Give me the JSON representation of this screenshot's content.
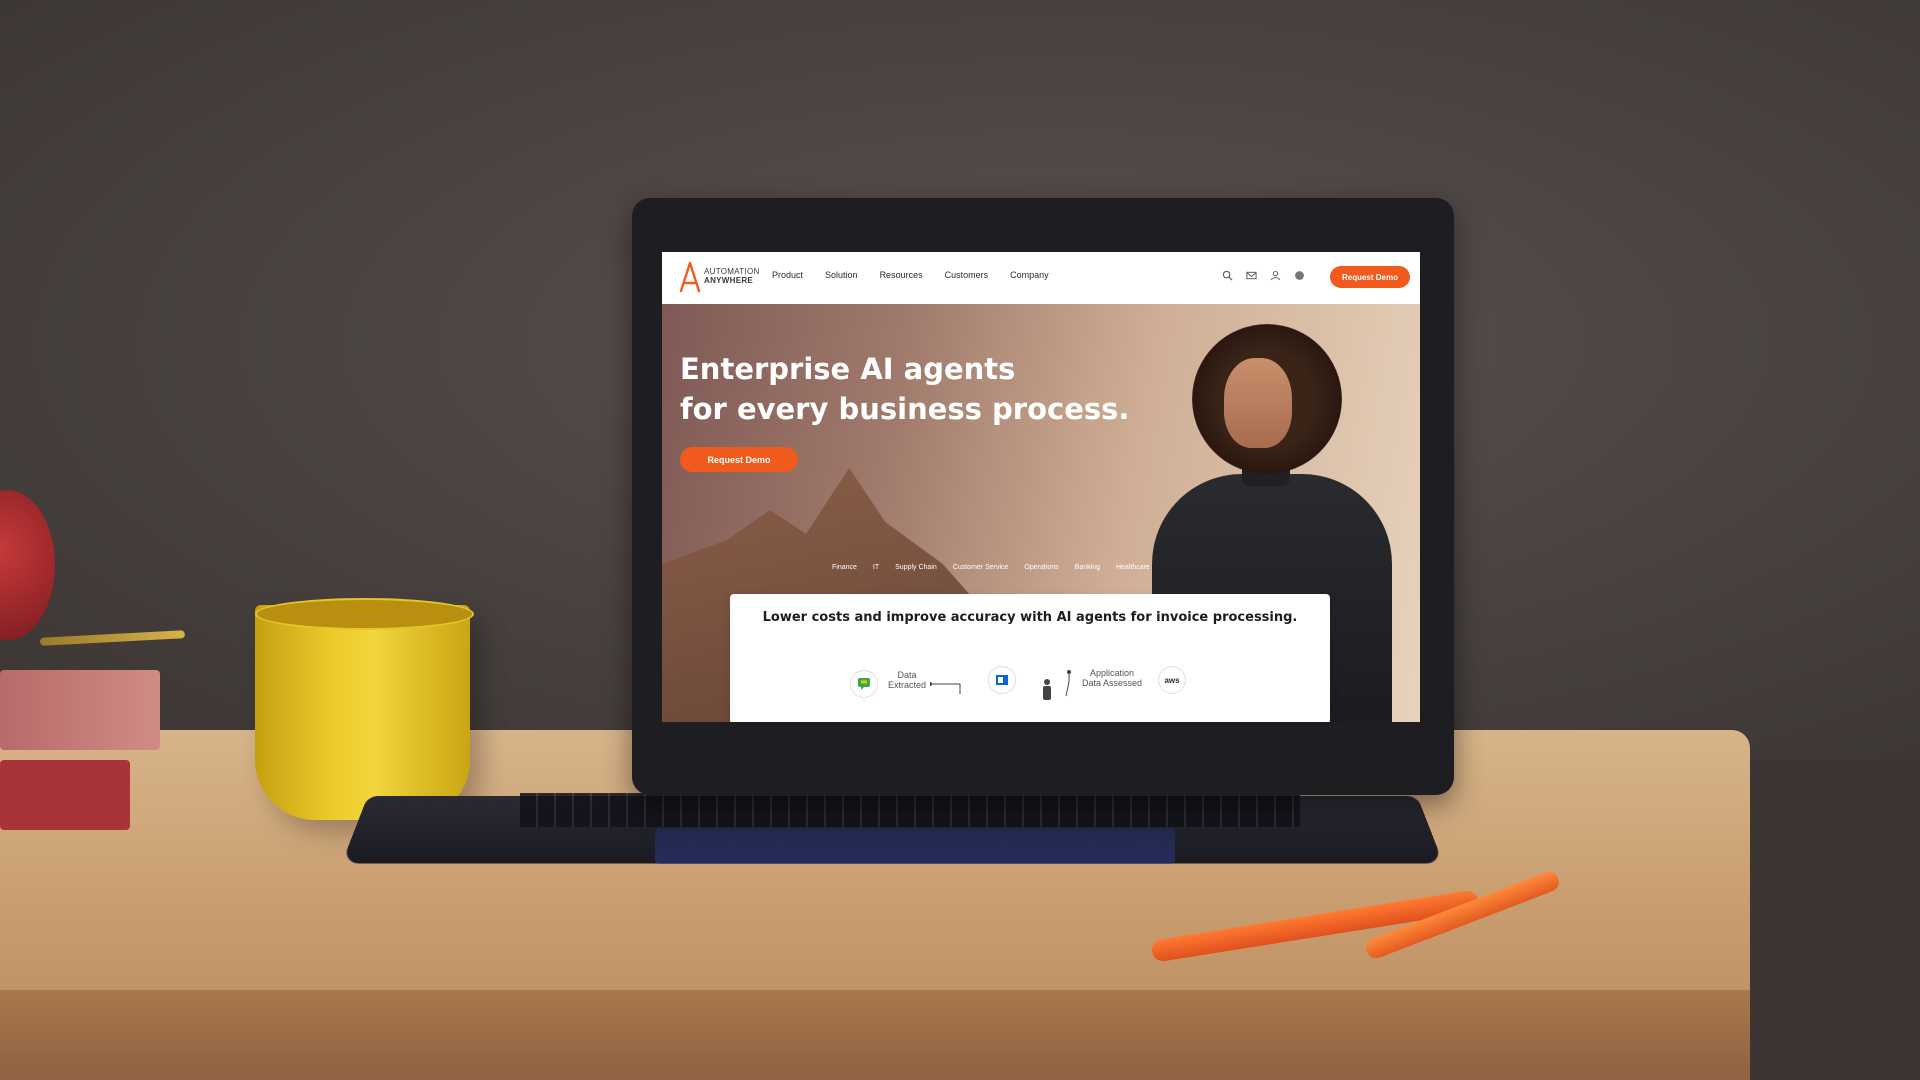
{
  "brand": {
    "logo_line1": "AUTOMATION",
    "logo_line2": "ANYWHERE",
    "accent_color": "#f05a1c"
  },
  "nav": {
    "items": [
      "Product",
      "Solution",
      "Resources",
      "Customers",
      "Company"
    ],
    "icons": [
      "search-icon",
      "mail-icon",
      "user-icon",
      "globe-icon"
    ],
    "cta_label": "Request Demo"
  },
  "hero": {
    "title_line1": "Enterprise AI agents",
    "title_line2": "for every business process.",
    "cta_label": "Request Demo"
  },
  "tabs": [
    "Finance",
    "IT",
    "Supply Chain",
    "Customer Service",
    "Operations",
    "Banking",
    "Healthcare"
  ],
  "card": {
    "headline": "Lower costs and improve accuracy with AI agents for invoice processing.",
    "flow": {
      "step1_label_line1": "Data",
      "step1_label_line2": "Extracted",
      "step2_label_line1": "Application",
      "step2_label_line2": "Data Assessed",
      "aws_label": "aws"
    }
  }
}
